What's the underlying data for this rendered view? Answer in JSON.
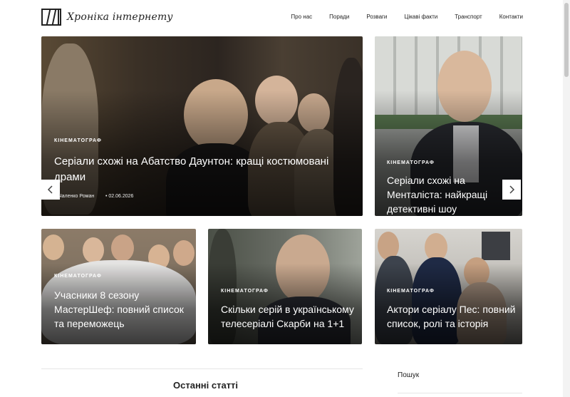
{
  "header": {
    "logo_text": "Хроніка інтернету",
    "nav": [
      "Про нас",
      "Поради",
      "Розваги",
      "Цікаві факти",
      "Транспорт",
      "Контакти"
    ]
  },
  "featured": {
    "category": "КІНЕМАТОГРАФ",
    "title": "Серіали схожі на Абатство Даунтон: кращі костюмовані драми",
    "author": "Чаленко Роман",
    "date": "02.06.2026"
  },
  "side_card": {
    "category": "КІНЕМАТОГРАФ",
    "title": "Серіали схожі на Менталіста: найкращі детективні шоу"
  },
  "cards": [
    {
      "category": "КІНЕМАТОГРАФ",
      "title": "Учасники 8 сезону МастерШеф: повний список та переможець"
    },
    {
      "category": "КІНЕМАТОГРАФ",
      "title": "Скільки серій в українському телесеріалі Скарби на 1+1"
    },
    {
      "category": "КІНЕМАТОГРАФ",
      "title": "Актори серіалу Пес: повний список, ролі та історія"
    }
  ],
  "latest_title": "Останні статті",
  "search_label": "Пошук",
  "icons": {
    "prev": "chevron-left-icon",
    "next": "chevron-right-icon"
  }
}
